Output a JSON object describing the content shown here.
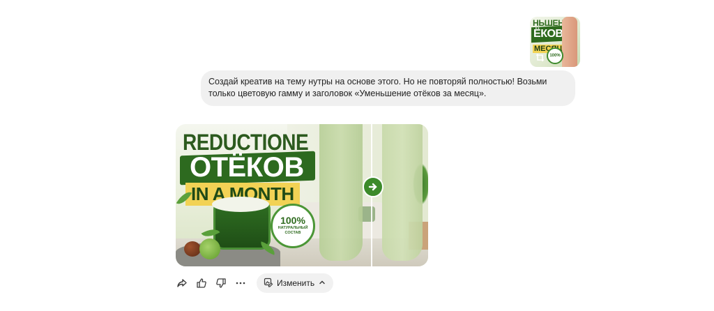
{
  "attachment": {
    "line1": "НЬШЕНИЕ",
    "line2": "ЁКОВ",
    "line3": "МЕСЯЦ",
    "badge": "100%",
    "crop_icon": "crop-icon"
  },
  "user_message": {
    "text": "Создай креатив на тему нутры на основе этого. Но не повторяй полностью! Возьми только цветовую гамму и заголовок «Уменьшение отёков за месяц»."
  },
  "generated_image": {
    "title_line1": "REDUCTIONE",
    "title_line2": "ОТЁКОВ",
    "title_line3": "IN A MONTH",
    "badge_percent": "100%",
    "badge_line1": "НАТУРАЛЬНЫЙ",
    "badge_line2": "СОСТАВ",
    "arrow_icon": "arrow-right-icon",
    "colors": {
      "green_dark": "#2d6a1f",
      "green_light": "#5aa03b",
      "yellow": "#f2d255"
    }
  },
  "toolbar": {
    "edit_label": "Изменить",
    "icons": [
      "share-icon",
      "thumbs-up-icon",
      "thumbs-down-icon",
      "more-icon",
      "edit-image-icon",
      "chevron-up-icon"
    ]
  }
}
